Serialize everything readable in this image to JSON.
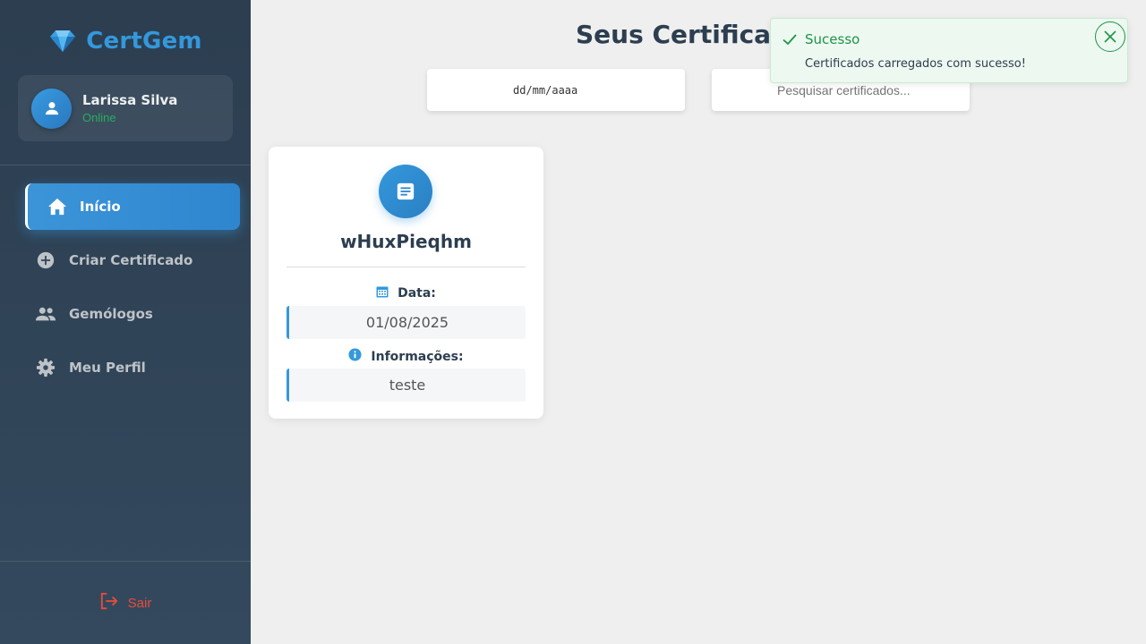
{
  "brand": {
    "name": "CertGem",
    "icon": "diamond-icon"
  },
  "user": {
    "name": "Larissa Silva",
    "status": "Online"
  },
  "nav": {
    "items": [
      {
        "label": "Início",
        "icon": "home-icon",
        "active": true
      },
      {
        "label": "Criar Certificado",
        "icon": "plus-circle-icon",
        "active": false
      },
      {
        "label": "Gemólogos",
        "icon": "people-icon",
        "active": false
      },
      {
        "label": "Meu Perfil",
        "icon": "gear-icon",
        "active": false
      }
    ],
    "logout": "Sair"
  },
  "main": {
    "title": "Seus Certificados",
    "date_placeholder": "dd/mm/aaaa",
    "search_placeholder": "Pesquisar certificados..."
  },
  "certificates": [
    {
      "name": "wHuxPieqhm",
      "date_label": "Data:",
      "date": "01/08/2025",
      "info_label": "Informações:",
      "info": "teste"
    }
  ],
  "toast": {
    "title": "Sucesso",
    "message": "Certificados carregados com sucesso!"
  },
  "colors": {
    "sidebar_bg": "#2c3e50",
    "accent": "#3498db",
    "success": "#1e9448",
    "danger": "#e74c3c",
    "online": "#27ae60"
  }
}
